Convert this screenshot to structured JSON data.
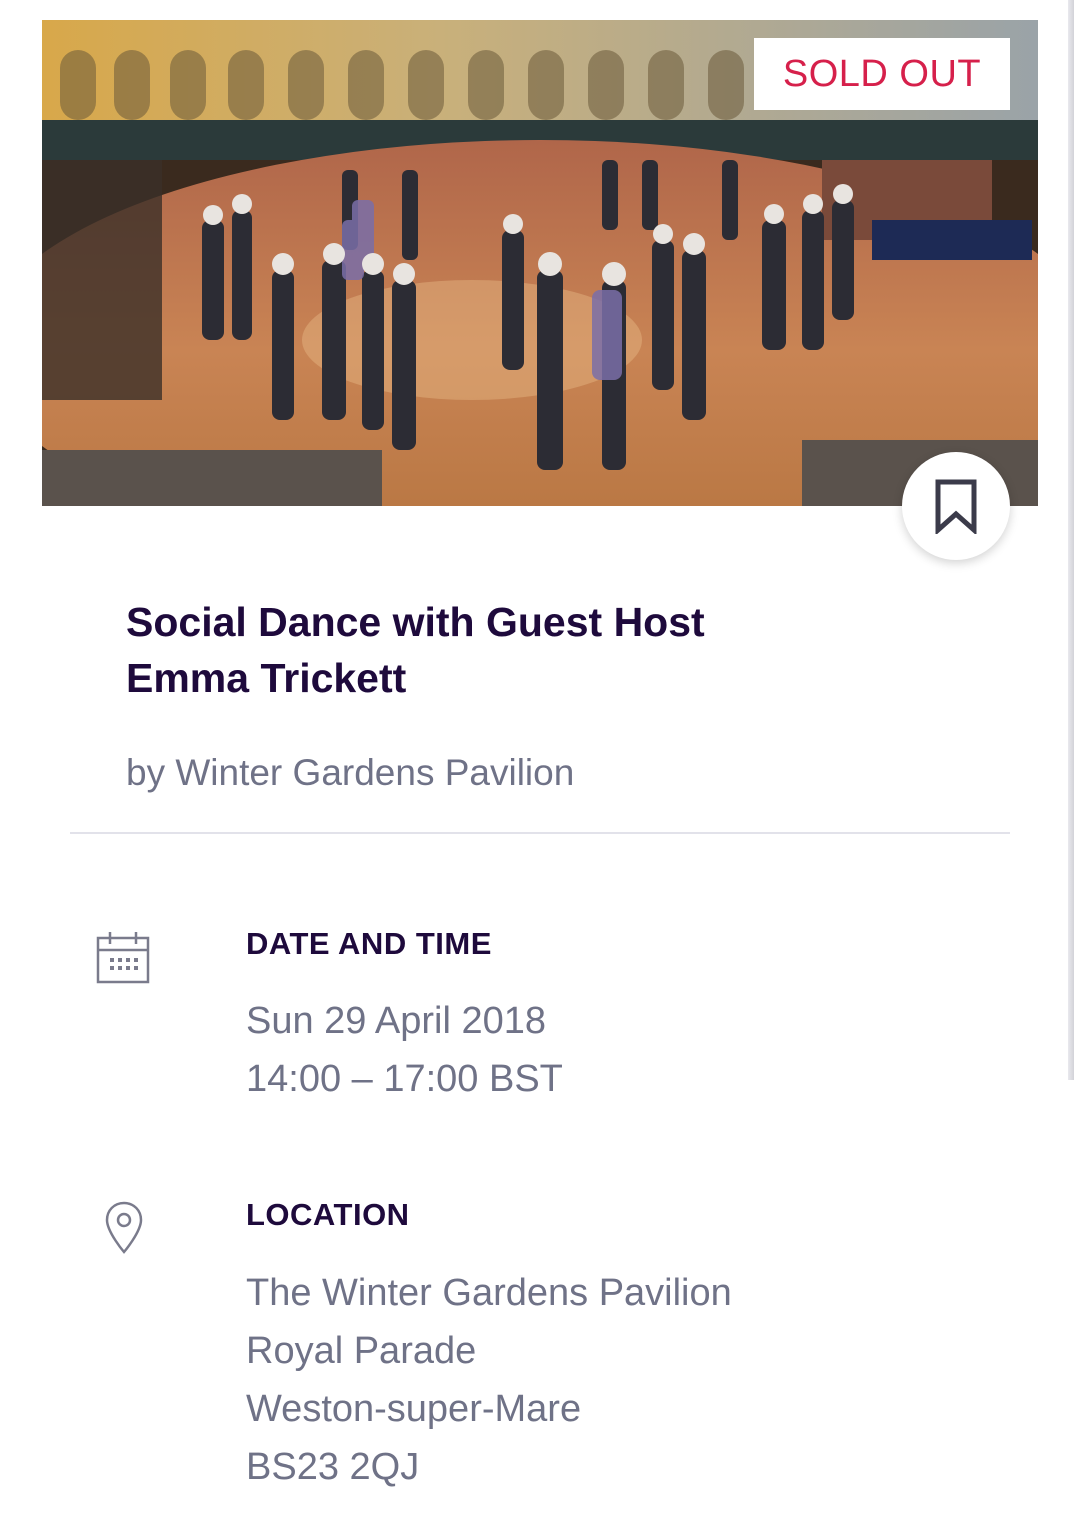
{
  "event": {
    "status_badge": "SOLD OUT",
    "title_line1": "Social Dance with Guest Host",
    "title_line2": "Emma Trickett",
    "organizer": "by Winter Gardens Pavilion"
  },
  "date_section": {
    "label": "DATE AND TIME",
    "date": "Sun 29 April 2018",
    "time": "14:00 – 17:00 BST",
    "icon": "calendar-icon"
  },
  "location_section": {
    "label": "LOCATION",
    "lines": [
      "The Winter Gardens Pavilion",
      "Royal Parade",
      "Weston-super-Mare",
      "BS23 2QJ"
    ],
    "icon": "map-pin-icon"
  },
  "colors": {
    "title": "#1e0a3c",
    "muted_text": "#6f7287",
    "sold_out": "#d6204b"
  }
}
